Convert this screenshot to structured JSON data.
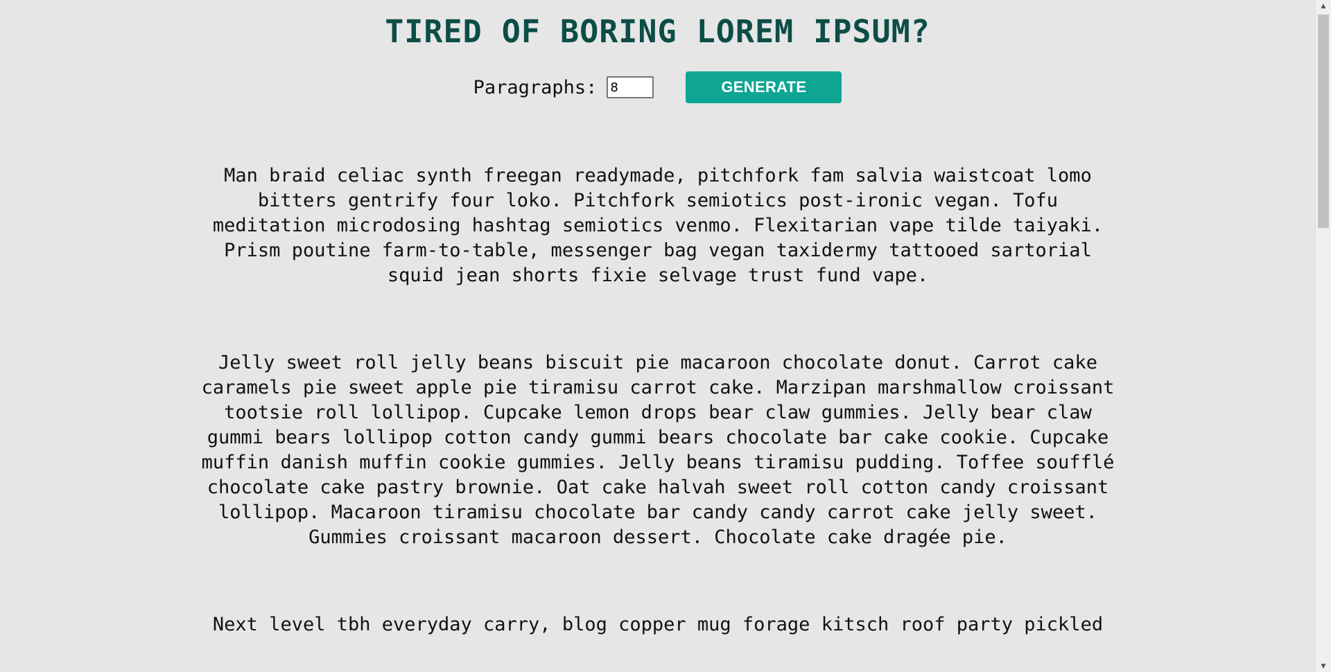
{
  "header": {
    "title": "TIRED OF BORING LOREM IPSUM?"
  },
  "controls": {
    "paragraphs_label": "Paragraphs:",
    "paragraphs_value": "8",
    "generate_label": "GENERATE"
  },
  "colors": {
    "title": "#0d4d47",
    "button": "#0ea693",
    "background": "#e6e6e6"
  },
  "paragraphs": [
    "Man braid celiac synth freegan readymade, pitchfork fam salvia waistcoat lomo bitters gentrify four loko. Pitchfork semiotics post-ironic vegan. Tofu meditation microdosing hashtag semiotics venmo. Flexitarian vape tilde taiyaki. Prism poutine farm-to-table, messenger bag vegan taxidermy tattooed sartorial squid jean shorts fixie selvage trust fund vape.",
    "Jelly sweet roll jelly beans biscuit pie macaroon chocolate donut. Carrot cake caramels pie sweet apple pie tiramisu carrot cake. Marzipan marshmallow croissant tootsie roll lollipop. Cupcake lemon drops bear claw gummies. Jelly bear claw gummi bears lollipop cotton candy gummi bears chocolate bar cake cookie. Cupcake muffin danish muffin cookie gummies. Jelly beans tiramisu pudding. Toffee soufflé chocolate cake pastry brownie. Oat cake halvah sweet roll cotton candy croissant lollipop. Macaroon tiramisu chocolate bar candy candy carrot cake jelly sweet. Gummies croissant macaroon dessert. Chocolate cake dragée pie.",
    "Next level tbh everyday carry, blog copper mug forage kitsch roof party pickled"
  ]
}
